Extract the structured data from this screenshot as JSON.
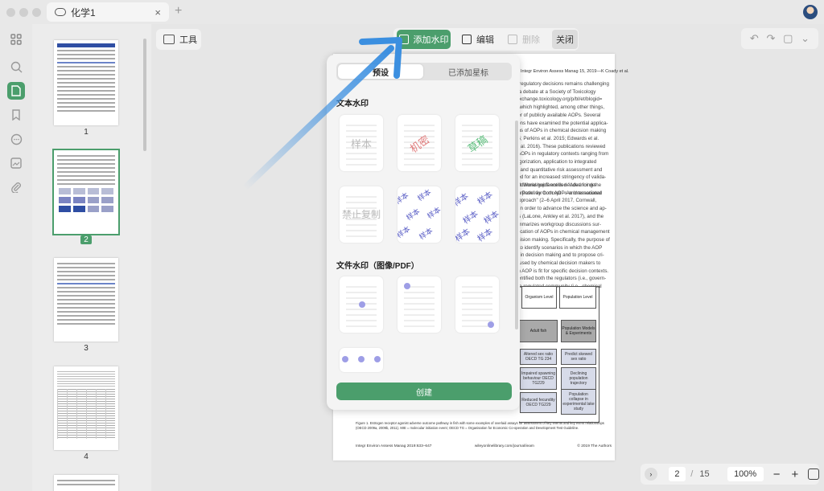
{
  "window": {
    "tab_title": "化学1",
    "tab_close": "×",
    "new_tab": "+"
  },
  "rail": {
    "icons": [
      "grid-icon",
      "search-icon",
      "pages-icon",
      "bookmark-icon",
      "comment-icon",
      "image-icon",
      "attachment-icon"
    ]
  },
  "thumbnails": {
    "pages": [
      "1",
      "2",
      "3",
      "4"
    ],
    "selected": "2"
  },
  "toolbar": {
    "tools_label": "工具",
    "add_watermark_label": "添加水印",
    "edit_label": "编辑",
    "delete_label": "删除",
    "close_label": "关闭",
    "undo": "↶",
    "redo": "↷",
    "save": "▢",
    "more": "⌄"
  },
  "document": {
    "header": "Integr Environ Assess Manag 15, 2019—K Coady et al.",
    "para1": [
      "o regulatory decisions remains challenging",
      "y a debate at a Society of Toxicology",
      "toxchange.toxicology.org/p/bl/et/blogid=",
      "), which highlighted, among other things,",
      "ber of publicly available AOPs. Several",
      "tions have examined the potential applica-",
      "ons of AOPs in chemical decision making",
      "15; Perkins et al. 2015; Edwards et al.",
      "et al. 2016). These publications reviewed",
      "f AOPs in regulatory contexts ranging from",
      "tegorization, application to integrated",
      "s, and quantitative risk assessment and",
      "eed for an increased stringency of valida-",
      "additional guidance is needed for de-",
      "purpose\" for both AOPs and associated"
    ],
    "para2": [
      "ion Workshop® entitled \"Advancing the",
      "he Pathway Concept – An International",
      "Approach\" (2–6 April 2017, Cornwall,",
      "d in order to advance the science and ap-",
      "Ps (LaLone, Ankley et al. 2017), and the",
      "ummarizes workgroup discussions sur-",
      "plication of AOPs in chemical management",
      "ecision making. Specifically, the purpose of",
      "s to identify scenarios in which the AOP",
      "ul in decision making and to propose cri-",
      "e used by chemical decision makers to",
      "an AOP is fit for specific decision contexts.",
      "dentified both the regulators (i.e., govern-",
      "the regulated community (i.e., chemical"
    ],
    "figure": {
      "organism_level": "Organism Level",
      "population_level": "Population Level",
      "adult_fish": "Adult fish",
      "population_models": "Population Models & Experiments",
      "altered_sex_ratio": "Altered sex ratio OECD TG 234",
      "predict_sex_ratio": "Predict skewed sex ratio",
      "impaired_spawning": "Impaired spawning behaviour OECD TG229",
      "declining_population": "Declining population trajectory",
      "reduced_fecundity": "Reduced fecundity OECD TG229",
      "population_collapse": "Population collapse in experimental lake study"
    },
    "caption": "Figure 1. Estrogen receptor agonist adverse outcome pathway in fish with some examples of overlaid assays for assessment of key events and key event relationships (OECD 2009a, 2009b, 2011). MIE = molecular initiation event; OECD TG = Organisation for Economic Co-operation and Development Test Guideline.",
    "footer_left": "Integr Environ Assess Manag 2019:633–647",
    "footer_mid": "wileyonlinelibrary.com/journal/ieam",
    "footer_right": "© 2019 The Authors"
  },
  "watermark_panel": {
    "tab_presets": "预设",
    "tab_added": "已添加星标",
    "section_text": "文本水印",
    "section_file": "文件水印（图像/PDF）",
    "text_presets": [
      "样本",
      "机密",
      "草稿",
      "禁止复制",
      "样本",
      "样本"
    ],
    "create_label": "创建"
  },
  "statusbar": {
    "current_page": "2",
    "separator": "/",
    "total_pages": "15",
    "zoom": "100%",
    "zoom_out": "−",
    "zoom_in": "+"
  },
  "colors": {
    "accent": "#4b9e6c",
    "arrow": "#3b8fe0",
    "tile_text": "#5b5fc6"
  }
}
